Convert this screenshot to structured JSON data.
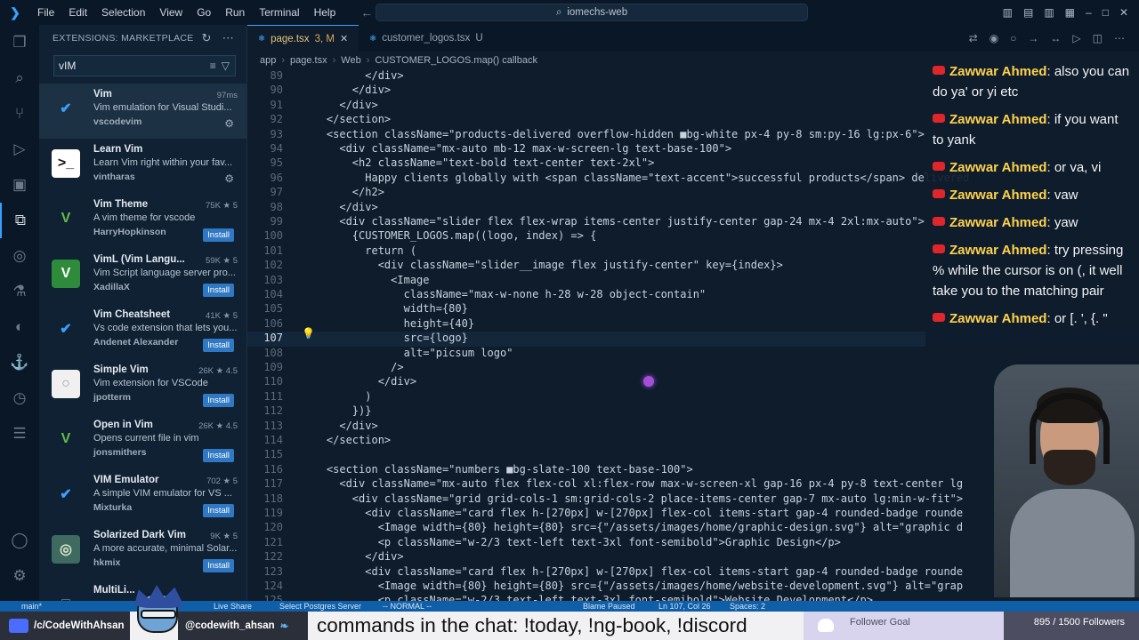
{
  "titlebar": {
    "menu": [
      "File",
      "Edit",
      "Selection",
      "View",
      "Go",
      "Run",
      "Terminal",
      "Help"
    ],
    "search": "iomechs-web"
  },
  "sidebar": {
    "title": "EXTENSIONS: MARKETPLACE",
    "search_value": "vIM",
    "extensions": [
      {
        "name": "Vim",
        "desc": "Vim emulation for Visual Studi...",
        "publisher": "vscodevim",
        "stats": "97ms",
        "action": ""
      },
      {
        "name": "Learn Vim",
        "desc": "Learn Vim right within your fav...",
        "publisher": "vintharas",
        "stats": "",
        "action": ""
      },
      {
        "name": "Vim Theme",
        "desc": "A vim theme for vscode",
        "publisher": "HarryHopkinson",
        "stats": "75K ★ 5",
        "action": "Install"
      },
      {
        "name": "VimL (Vim Langu...",
        "desc": "Vim Script language server pro...",
        "publisher": "XadillaX",
        "stats": "59K ★ 5",
        "action": "Install"
      },
      {
        "name": "Vim Cheatsheet",
        "desc": "Vs code extension that lets you...",
        "publisher": "Andenet Alexander",
        "stats": "41K ★ 5",
        "action": "Install"
      },
      {
        "name": "Simple Vim",
        "desc": "Vim extension for VSCode",
        "publisher": "jpotterm",
        "stats": "26K ★ 4.5",
        "action": "Install"
      },
      {
        "name": "Open in Vim",
        "desc": "Opens current file in vim",
        "publisher": "jonsmithers",
        "stats": "26K ★ 4.5",
        "action": "Install"
      },
      {
        "name": "VIM Emulator",
        "desc": "A simple VIM emulator for VS ...",
        "publisher": "Mixturka",
        "stats": "702 ★ 5",
        "action": "Install"
      },
      {
        "name": "Solarized Dark Vim",
        "desc": "A more accurate, minimal Solar...",
        "publisher": "hkmix",
        "stats": "9K ★ 5",
        "action": "Install"
      },
      {
        "name": "MultiLi...",
        "desc": "",
        "publisher": "",
        "stats": "",
        "action": ""
      }
    ]
  },
  "editor": {
    "tabs": [
      {
        "label": "page.tsx",
        "status": "3, M"
      },
      {
        "label": "customer_logos.tsx",
        "status": "U"
      }
    ],
    "breadcrumbs": [
      "app",
      "page.tsx",
      "Web",
      "CUSTOMER_LOGOS.map() callback"
    ],
    "lines": [
      {
        "n": "89",
        "text": "          </div>"
      },
      {
        "n": "90",
        "text": "        </div>"
      },
      {
        "n": "91",
        "text": "      </div>"
      },
      {
        "n": "92",
        "text": "    </section>"
      },
      {
        "n": "93",
        "text": "    <section className=\"products-delivered overflow-hidden ■bg-white px-4 py-8 sm:py-16 lg:px-6\">"
      },
      {
        "n": "94",
        "text": "      <div className=\"mx-auto mb-12 max-w-screen-lg text-base-100\">"
      },
      {
        "n": "95",
        "text": "        <h2 className=\"text-bold text-center text-2xl\">"
      },
      {
        "n": "96",
        "text": "          Happy clients globally with <span className=\"text-accent\">successful products</span> delivered"
      },
      {
        "n": "97",
        "text": "        </h2>"
      },
      {
        "n": "98",
        "text": "      </div>"
      },
      {
        "n": "99",
        "text": "      <div className=\"slider flex flex-wrap items-center justify-center gap-24 mx-4 2xl:mx-auto\">"
      },
      {
        "n": "100",
        "text": "        {CUSTOMER_LOGOS.map((logo, index) => {"
      },
      {
        "n": "101",
        "text": "          return ("
      },
      {
        "n": "102",
        "text": "            <div className=\"slider__image flex justify-center\" key={index}>"
      },
      {
        "n": "103",
        "text": "              <Image"
      },
      {
        "n": "104",
        "text": "                className=\"max-w-none h-28 w-28 object-contain\""
      },
      {
        "n": "105",
        "text": "                width={80}"
      },
      {
        "n": "106",
        "text": "                height={40}"
      },
      {
        "n": "107",
        "text": "                src={logo}"
      },
      {
        "n": "108",
        "text": "                alt=\"picsum logo\""
      },
      {
        "n": "109",
        "text": "              />"
      },
      {
        "n": "110",
        "text": "            </div>"
      },
      {
        "n": "111",
        "text": "          )"
      },
      {
        "n": "112",
        "text": "        })}"
      },
      {
        "n": "113",
        "text": "      </div>"
      },
      {
        "n": "114",
        "text": "    </section>"
      },
      {
        "n": "115",
        "text": ""
      },
      {
        "n": "116",
        "text": "    <section className=\"numbers ■bg-slate-100 text-base-100\">"
      },
      {
        "n": "117",
        "text": "      <div className=\"mx-auto flex flex-col xl:flex-row max-w-screen-xl gap-16 px-4 py-8 text-center lg"
      },
      {
        "n": "118",
        "text": "        <div className=\"grid grid-cols-1 sm:grid-cols-2 place-items-center gap-7 mx-auto lg:min-w-fit\">"
      },
      {
        "n": "119",
        "text": "          <div className=\"card flex h-[270px] w-[270px] flex-col items-start gap-4 rounded-badge rounde"
      },
      {
        "n": "120",
        "text": "            <Image width={80} height={80} src={\"/assets/images/home/graphic-design.svg\"} alt=\"graphic d"
      },
      {
        "n": "121",
        "text": "            <p className=\"w-2/3 text-left text-3xl font-semibold\">Graphic Design</p>"
      },
      {
        "n": "122",
        "text": "          </div>"
      },
      {
        "n": "123",
        "text": "          <div className=\"card flex h-[270px] w-[270px] flex-col items-start gap-4 rounded-badge rounde"
      },
      {
        "n": "124",
        "text": "            <Image width={80} height={80} src={\"/assets/images/home/website-development.svg\"} alt=\"grap"
      },
      {
        "n": "125",
        "text": "            <p className=\"w-2/3 text-left text-3xl font-semibold\">Website Development</p>"
      }
    ],
    "current_line": "107"
  },
  "chat": [
    {
      "author": "Zawwar Ahmed",
      "text": "also you can do ya' or yi etc"
    },
    {
      "author": "Zawwar Ahmed",
      "text": "if you want to yank"
    },
    {
      "author": "Zawwar Ahmed",
      "text": "or va, vi"
    },
    {
      "author": "Zawwar Ahmed",
      "text": "vaw"
    },
    {
      "author": "Zawwar Ahmed",
      "text": "yaw"
    },
    {
      "author": "Zawwar Ahmed",
      "text": "try pressing % while the cursor is on (, it well take you to the matching pair"
    },
    {
      "author": "Zawwar Ahmed",
      "text": "or [. ', {. \""
    }
  ],
  "statusbar": {
    "branch": "main*",
    "live_share": "Live Share",
    "postgres": "Select Postgres Server",
    "mode": "-- NORMAL --",
    "blame": "Blame Paused",
    "position": "Ln 107, Col 26",
    "spaces": "Spaces: 2"
  },
  "overlay": {
    "handle1": "/c/CodeWithAhsan",
    "handle2": "@codewith_ahsan",
    "ticker": "commands in the chat:  !today, !ng-book, !discord",
    "goal_label": "Follower Goal",
    "goal_count": "895 / 1500 Followers",
    "goal_progress": 0.597
  },
  "colors": {
    "accent": "#3aa0ff",
    "install": "#2f78c4",
    "chat_author": "#ffd24a"
  }
}
